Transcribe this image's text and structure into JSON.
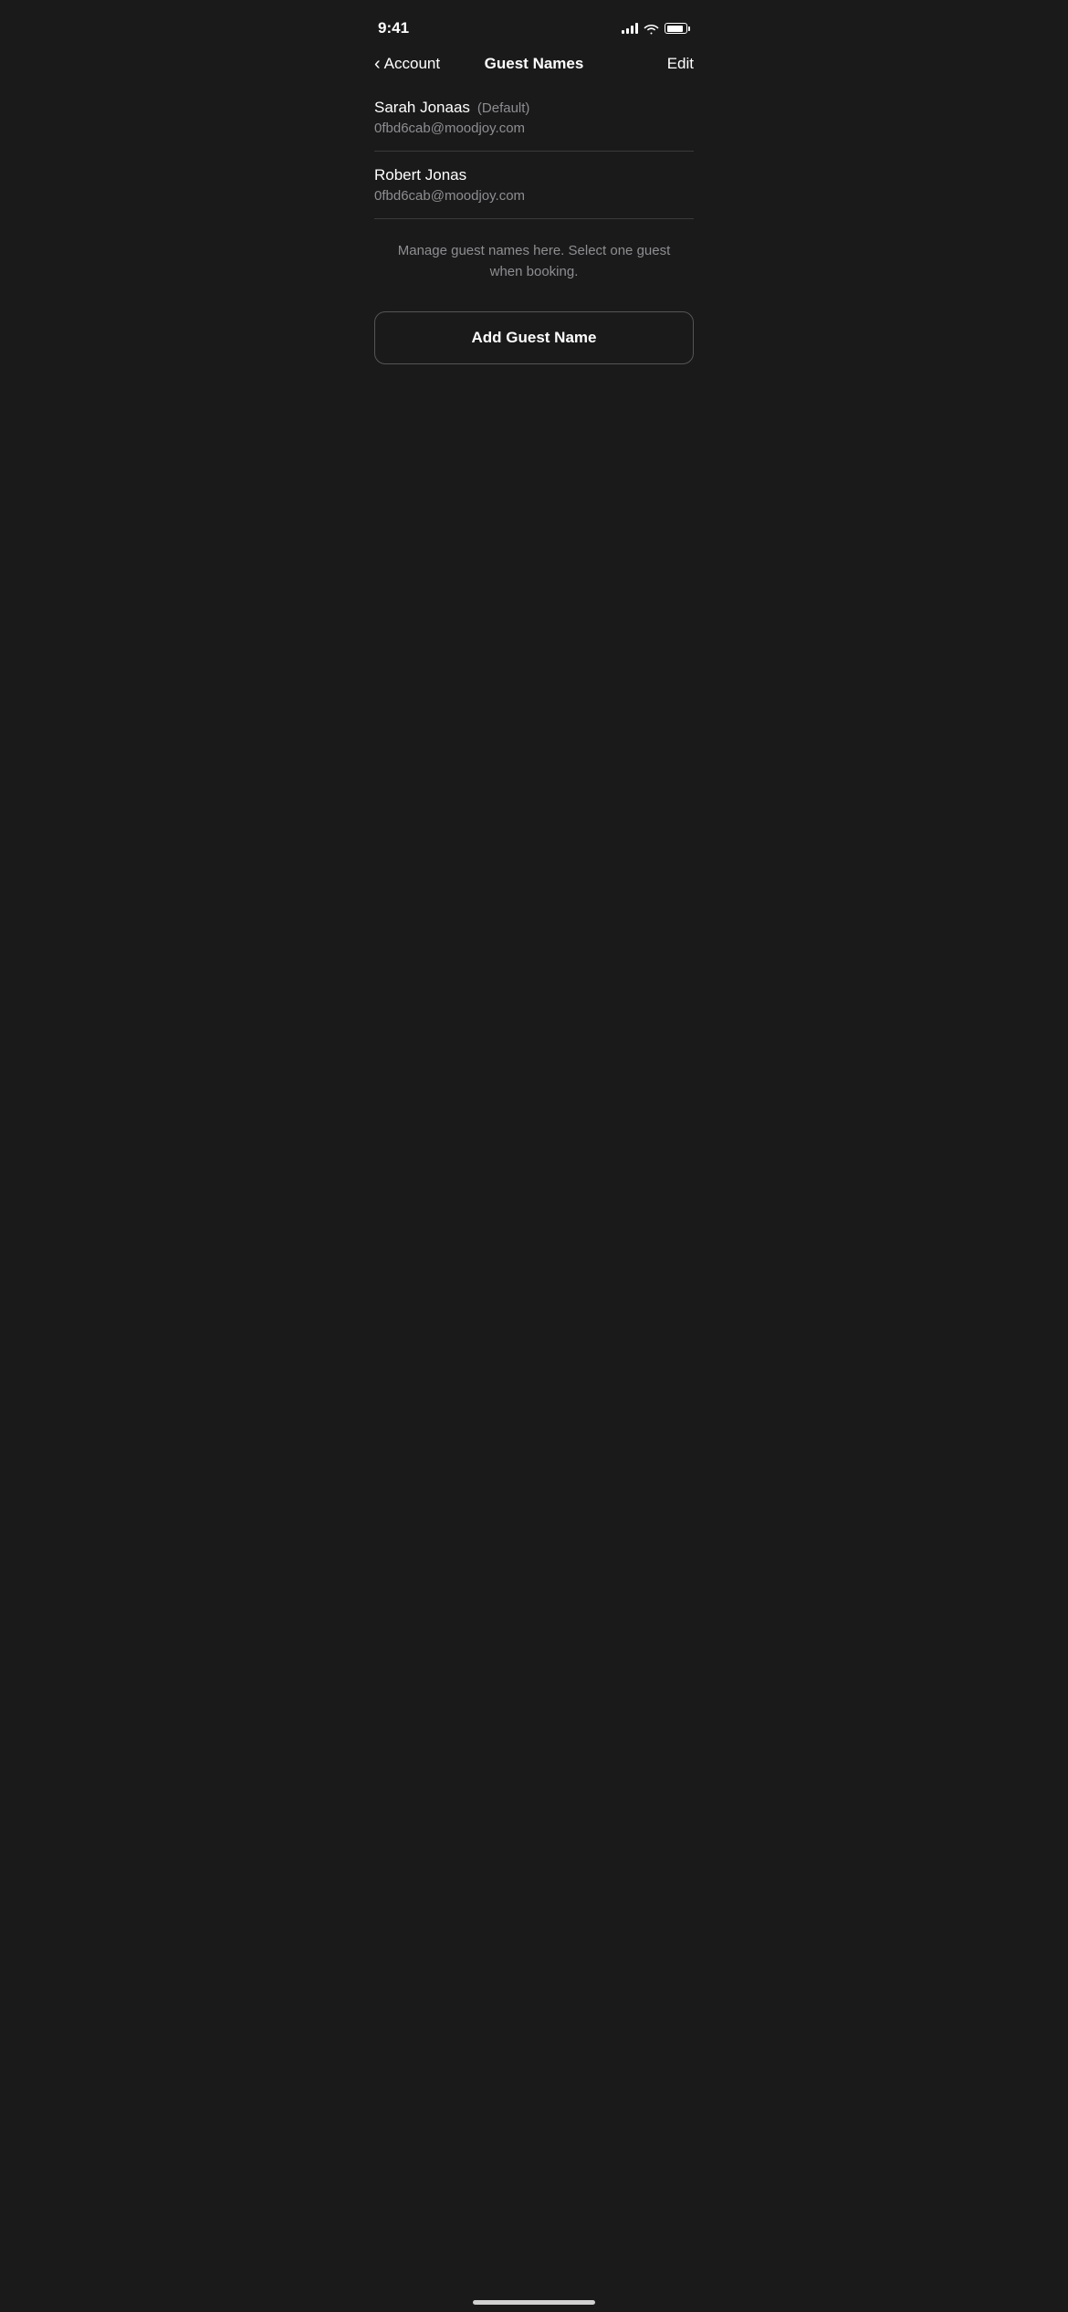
{
  "statusBar": {
    "time": "9:41"
  },
  "navBar": {
    "backLabel": "Account",
    "title": "Guest Names",
    "editLabel": "Edit"
  },
  "guests": [
    {
      "name": "Sarah Jonaas",
      "defaultBadge": "(Default)",
      "email": "0fbd6cab@moodjoy.com"
    },
    {
      "name": "Robert Jonas",
      "defaultBadge": "",
      "email": "0fbd6cab@moodjoy.com"
    }
  ],
  "infoText": "Manage guest names here. Select one guest when booking.",
  "addButton": {
    "label": "Add Guest Name"
  }
}
